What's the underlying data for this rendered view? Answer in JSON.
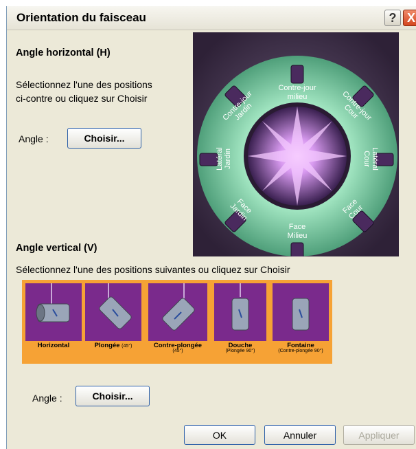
{
  "dialog": {
    "title": "Orientation du faisceau",
    "help_label": "?",
    "close_label": "X"
  },
  "horizontal": {
    "heading": "Angle horizontal (H)",
    "instructions_line1": "Sélectionnez l'une des positions",
    "instructions_line2": "ci-contre ou cliquez sur Choisir",
    "angle_label": "Angle :",
    "choose_label": "Choisir...",
    "positions": {
      "contre_jour_milieu": [
        "Contre-jour",
        "milieu"
      ],
      "contre_jour_cour": [
        "Contre-jour",
        "Cour"
      ],
      "contre_jour_jardin": [
        "Contre-jour",
        "Jardin"
      ],
      "lateral_jardin": [
        "Latéral",
        "Jardin"
      ],
      "lateral_cour": [
        "Latéral",
        "Cour"
      ],
      "face_jardin": [
        "Face",
        "Jardin"
      ],
      "face_cour": [
        "Face",
        "Cour"
      ],
      "face_milieu": [
        "Face",
        "Milieu"
      ]
    }
  },
  "vertical": {
    "heading": "Angle vertical (V)",
    "instructions": "Sélectionnez l'une des positions suivantes ou cliquez sur Choisir",
    "angle_label": "Angle :",
    "choose_label": "Choisir...",
    "positions": [
      {
        "label": "Horizontal",
        "sub": "",
        "note": ""
      },
      {
        "label": "Plongée",
        "sub": "(45°)",
        "note": ""
      },
      {
        "label": "Contre-plongée",
        "sub": "",
        "note": "(45°)"
      },
      {
        "label": "Douche",
        "sub": "",
        "note": "(Plongée 90°)"
      },
      {
        "label": "Fontaine",
        "sub": "",
        "note": "(Contre-plongée 90°)"
      }
    ]
  },
  "footer": {
    "ok_label": "OK",
    "cancel_label": "Annuler",
    "apply_label": "Appliquer"
  },
  "colors": {
    "accent_green": "#6fbf96",
    "center_purple": "#b77ee0",
    "strip_orange": "#f6a235",
    "cell_purple": "#7a2a8c"
  }
}
